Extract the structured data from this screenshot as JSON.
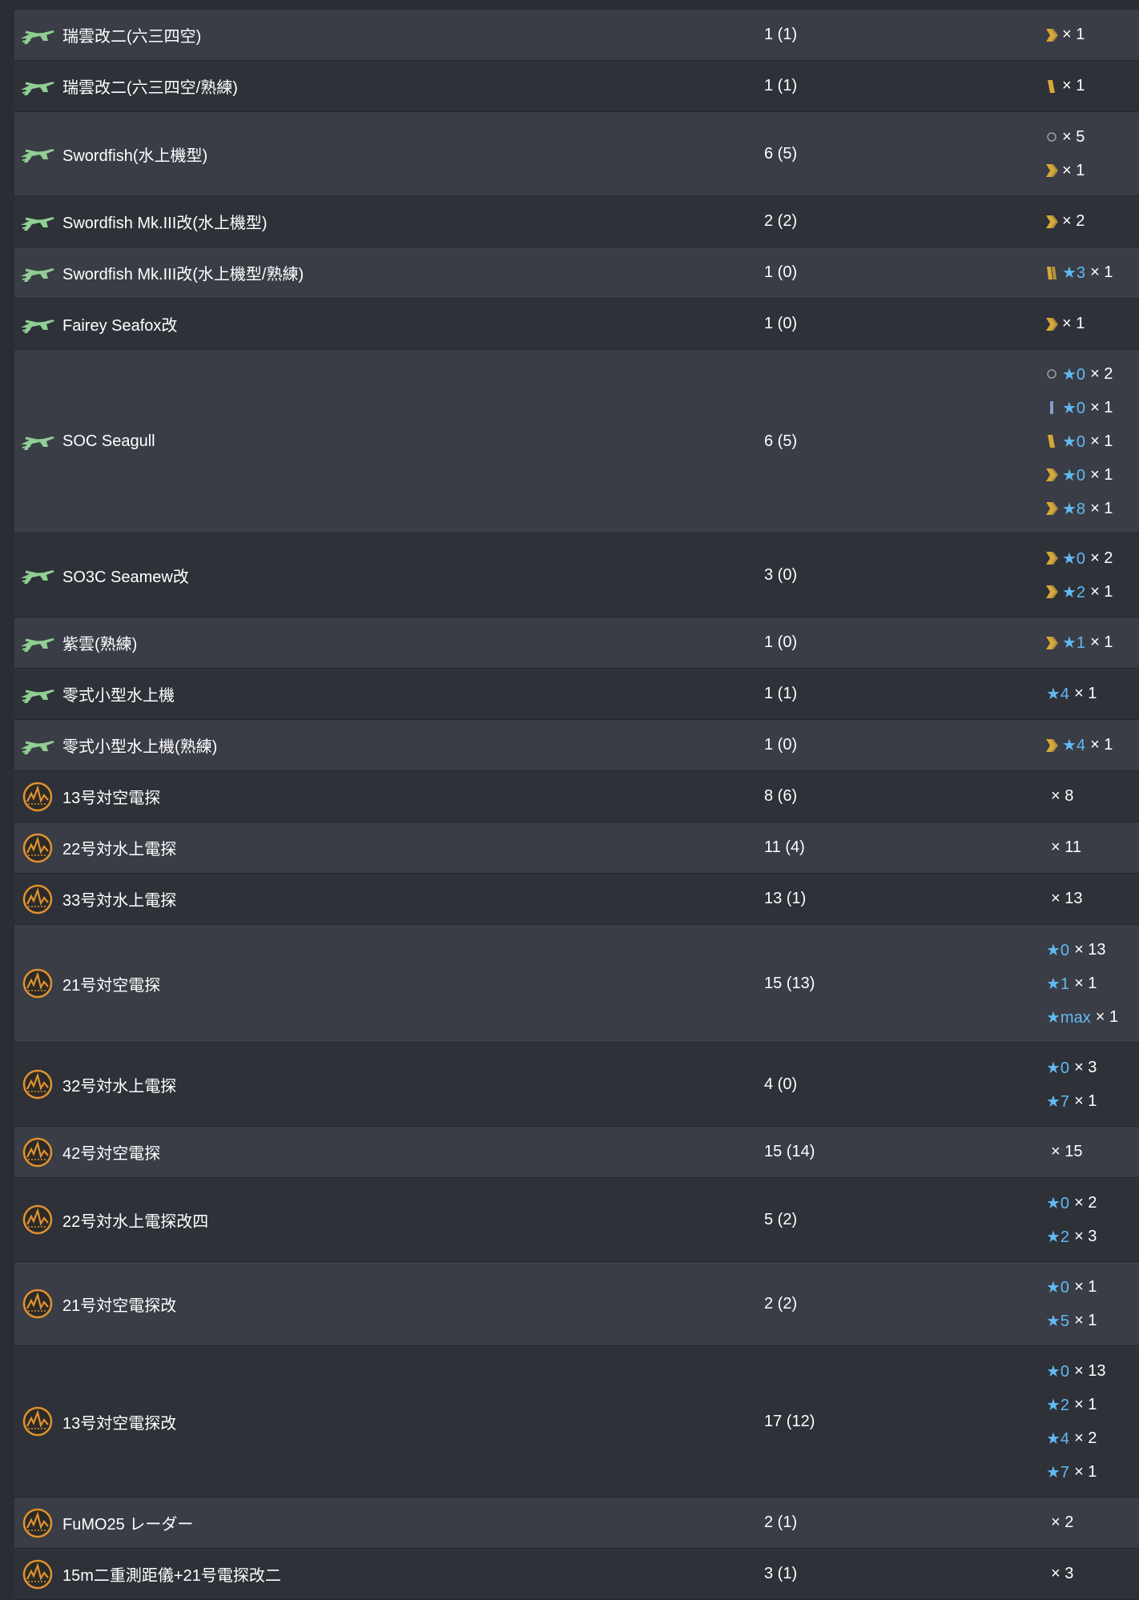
{
  "colors": {
    "row_odd": "#3a3d45",
    "row_even": "#2e3138",
    "star": "#62b9f2",
    "plane_icon": "#8fcf92",
    "radar_icon": "#e1922e",
    "proficiency_gold": "#d6a83a",
    "proficiency_blue": "#7fa0c8"
  },
  "rows": [
    {
      "icon": "seaplane-icon",
      "name": "瑞雲改二(六三四空)",
      "count": "1 (1)",
      "levels": [
        {
          "prof": "chevron-double",
          "star": "",
          "qty": "× 1"
        }
      ]
    },
    {
      "icon": "seaplane-icon",
      "name": "瑞雲改二(六三四空/熟練)",
      "count": "1 (1)",
      "levels": [
        {
          "prof": "bar-gold",
          "star": "",
          "qty": "× 1"
        }
      ]
    },
    {
      "icon": "seaplane-icon",
      "name": "Swordfish(水上機型)",
      "count": "6 (5)",
      "levels": [
        {
          "prof": "circle",
          "star": "",
          "qty": "× 5"
        },
        {
          "prof": "chevron-double",
          "star": "",
          "qty": "× 1"
        }
      ]
    },
    {
      "icon": "seaplane-icon",
      "name": "Swordfish Mk.III改(水上機型)",
      "count": "2 (2)",
      "levels": [
        {
          "prof": "chevron-double",
          "star": "",
          "qty": "× 2"
        }
      ]
    },
    {
      "icon": "seaplane-icon",
      "name": "Swordfish Mk.III改(水上機型/熟練)",
      "count": "1 (0)",
      "levels": [
        {
          "prof": "bar-gold-double",
          "star": "★3",
          "qty": "× 1"
        }
      ]
    },
    {
      "icon": "seaplane-icon",
      "name": "Fairey Seafox改",
      "count": "1 (0)",
      "levels": [
        {
          "prof": "chevron-double",
          "star": "",
          "qty": "× 1"
        }
      ]
    },
    {
      "icon": "seaplane-icon",
      "name": "SOC Seagull",
      "count": "6 (5)",
      "levels": [
        {
          "prof": "circle",
          "star": "★0",
          "qty": "× 2"
        },
        {
          "prof": "bar-blue",
          "star": "★0",
          "qty": "× 1"
        },
        {
          "prof": "bar-gold",
          "star": "★0",
          "qty": "× 1"
        },
        {
          "prof": "chevron-double",
          "star": "★0",
          "qty": "× 1"
        },
        {
          "prof": "chevron-double",
          "star": "★8",
          "qty": "× 1"
        }
      ]
    },
    {
      "icon": "seaplane-icon",
      "name": "SO3C Seamew改",
      "count": "3 (0)",
      "levels": [
        {
          "prof": "chevron-double",
          "star": "★0",
          "qty": "× 2"
        },
        {
          "prof": "chevron-double",
          "star": "★2",
          "qty": "× 1"
        }
      ]
    },
    {
      "icon": "seaplane-icon",
      "name": "紫雲(熟練)",
      "count": "1 (0)",
      "levels": [
        {
          "prof": "chevron-double",
          "star": "★1",
          "qty": "× 1"
        }
      ]
    },
    {
      "icon": "seaplane-icon",
      "name": "零式小型水上機",
      "count": "1 (1)",
      "levels": [
        {
          "prof": "",
          "star": "★4",
          "qty": "× 1"
        }
      ]
    },
    {
      "icon": "seaplane-icon",
      "name": "零式小型水上機(熟練)",
      "count": "1 (0)",
      "levels": [
        {
          "prof": "chevron-double",
          "star": "★4",
          "qty": "× 1"
        }
      ]
    },
    {
      "icon": "radar-icon",
      "name": "13号対空電探",
      "count": "8 (6)",
      "levels": [
        {
          "prof": "",
          "star": "",
          "qty": "× 8"
        }
      ]
    },
    {
      "icon": "radar-icon",
      "name": "22号対水上電探",
      "count": "11 (4)",
      "levels": [
        {
          "prof": "",
          "star": "",
          "qty": "× 11"
        }
      ]
    },
    {
      "icon": "radar-icon",
      "name": "33号対水上電探",
      "count": "13 (1)",
      "levels": [
        {
          "prof": "",
          "star": "",
          "qty": "× 13"
        }
      ]
    },
    {
      "icon": "radar-icon",
      "name": "21号対空電探",
      "count": "15 (13)",
      "levels": [
        {
          "prof": "",
          "star": "★0",
          "qty": "× 13"
        },
        {
          "prof": "",
          "star": "★1",
          "qty": "× 1"
        },
        {
          "prof": "",
          "star": "★max",
          "qty": "× 1"
        }
      ]
    },
    {
      "icon": "radar-icon",
      "name": "32号対水上電探",
      "count": "4 (0)",
      "levels": [
        {
          "prof": "",
          "star": "★0",
          "qty": "× 3"
        },
        {
          "prof": "",
          "star": "★7",
          "qty": "× 1"
        }
      ]
    },
    {
      "icon": "radar-icon",
      "name": "42号対空電探",
      "count": "15 (14)",
      "levels": [
        {
          "prof": "",
          "star": "",
          "qty": "× 15"
        }
      ]
    },
    {
      "icon": "radar-icon",
      "name": "22号対水上電探改四",
      "count": "5 (2)",
      "levels": [
        {
          "prof": "",
          "star": "★0",
          "qty": "× 2"
        },
        {
          "prof": "",
          "star": "★2",
          "qty": "× 3"
        }
      ]
    },
    {
      "icon": "radar-icon",
      "name": "21号対空電探改",
      "count": "2 (2)",
      "levels": [
        {
          "prof": "",
          "star": "★0",
          "qty": "× 1"
        },
        {
          "prof": "",
          "star": "★5",
          "qty": "× 1"
        }
      ]
    },
    {
      "icon": "radar-icon",
      "name": "13号対空電探改",
      "count": "17 (12)",
      "levels": [
        {
          "prof": "",
          "star": "★0",
          "qty": "× 13"
        },
        {
          "prof": "",
          "star": "★2",
          "qty": "× 1"
        },
        {
          "prof": "",
          "star": "★4",
          "qty": "× 2"
        },
        {
          "prof": "",
          "star": "★7",
          "qty": "× 1"
        }
      ]
    },
    {
      "icon": "radar-icon",
      "name": "FuMO25 レーダー",
      "count": "2 (1)",
      "levels": [
        {
          "prof": "",
          "star": "",
          "qty": "× 2"
        }
      ]
    },
    {
      "icon": "radar-icon",
      "name": "15m二重測距儀+21号電探改二",
      "count": "3 (1)",
      "levels": [
        {
          "prof": "",
          "star": "",
          "qty": "× 3"
        }
      ]
    }
  ]
}
